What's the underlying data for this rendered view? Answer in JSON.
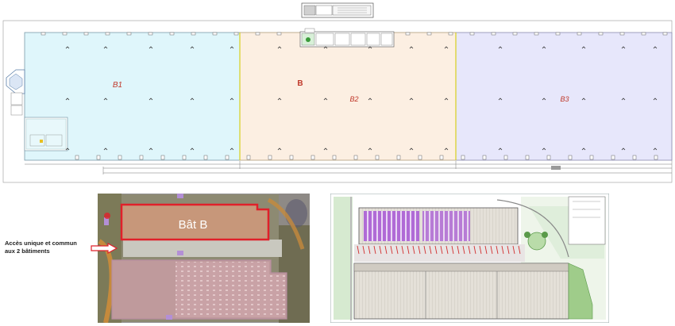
{
  "floor_plan": {
    "cells": [
      {
        "label": "B1",
        "fill": "#dff6fb"
      },
      {
        "label": "B2",
        "fill": "#fcefe2"
      },
      {
        "label": "B3",
        "fill": "#e7e7fb"
      }
    ],
    "building_label": "B",
    "cell_label_color": "#c0392b",
    "line_color": "#8a8a8a"
  },
  "aerial": {
    "building_label": "Bât B",
    "highlight_color": "#e0202a",
    "annotation": "Accès unique et commun\naux 2 bâtiments"
  }
}
